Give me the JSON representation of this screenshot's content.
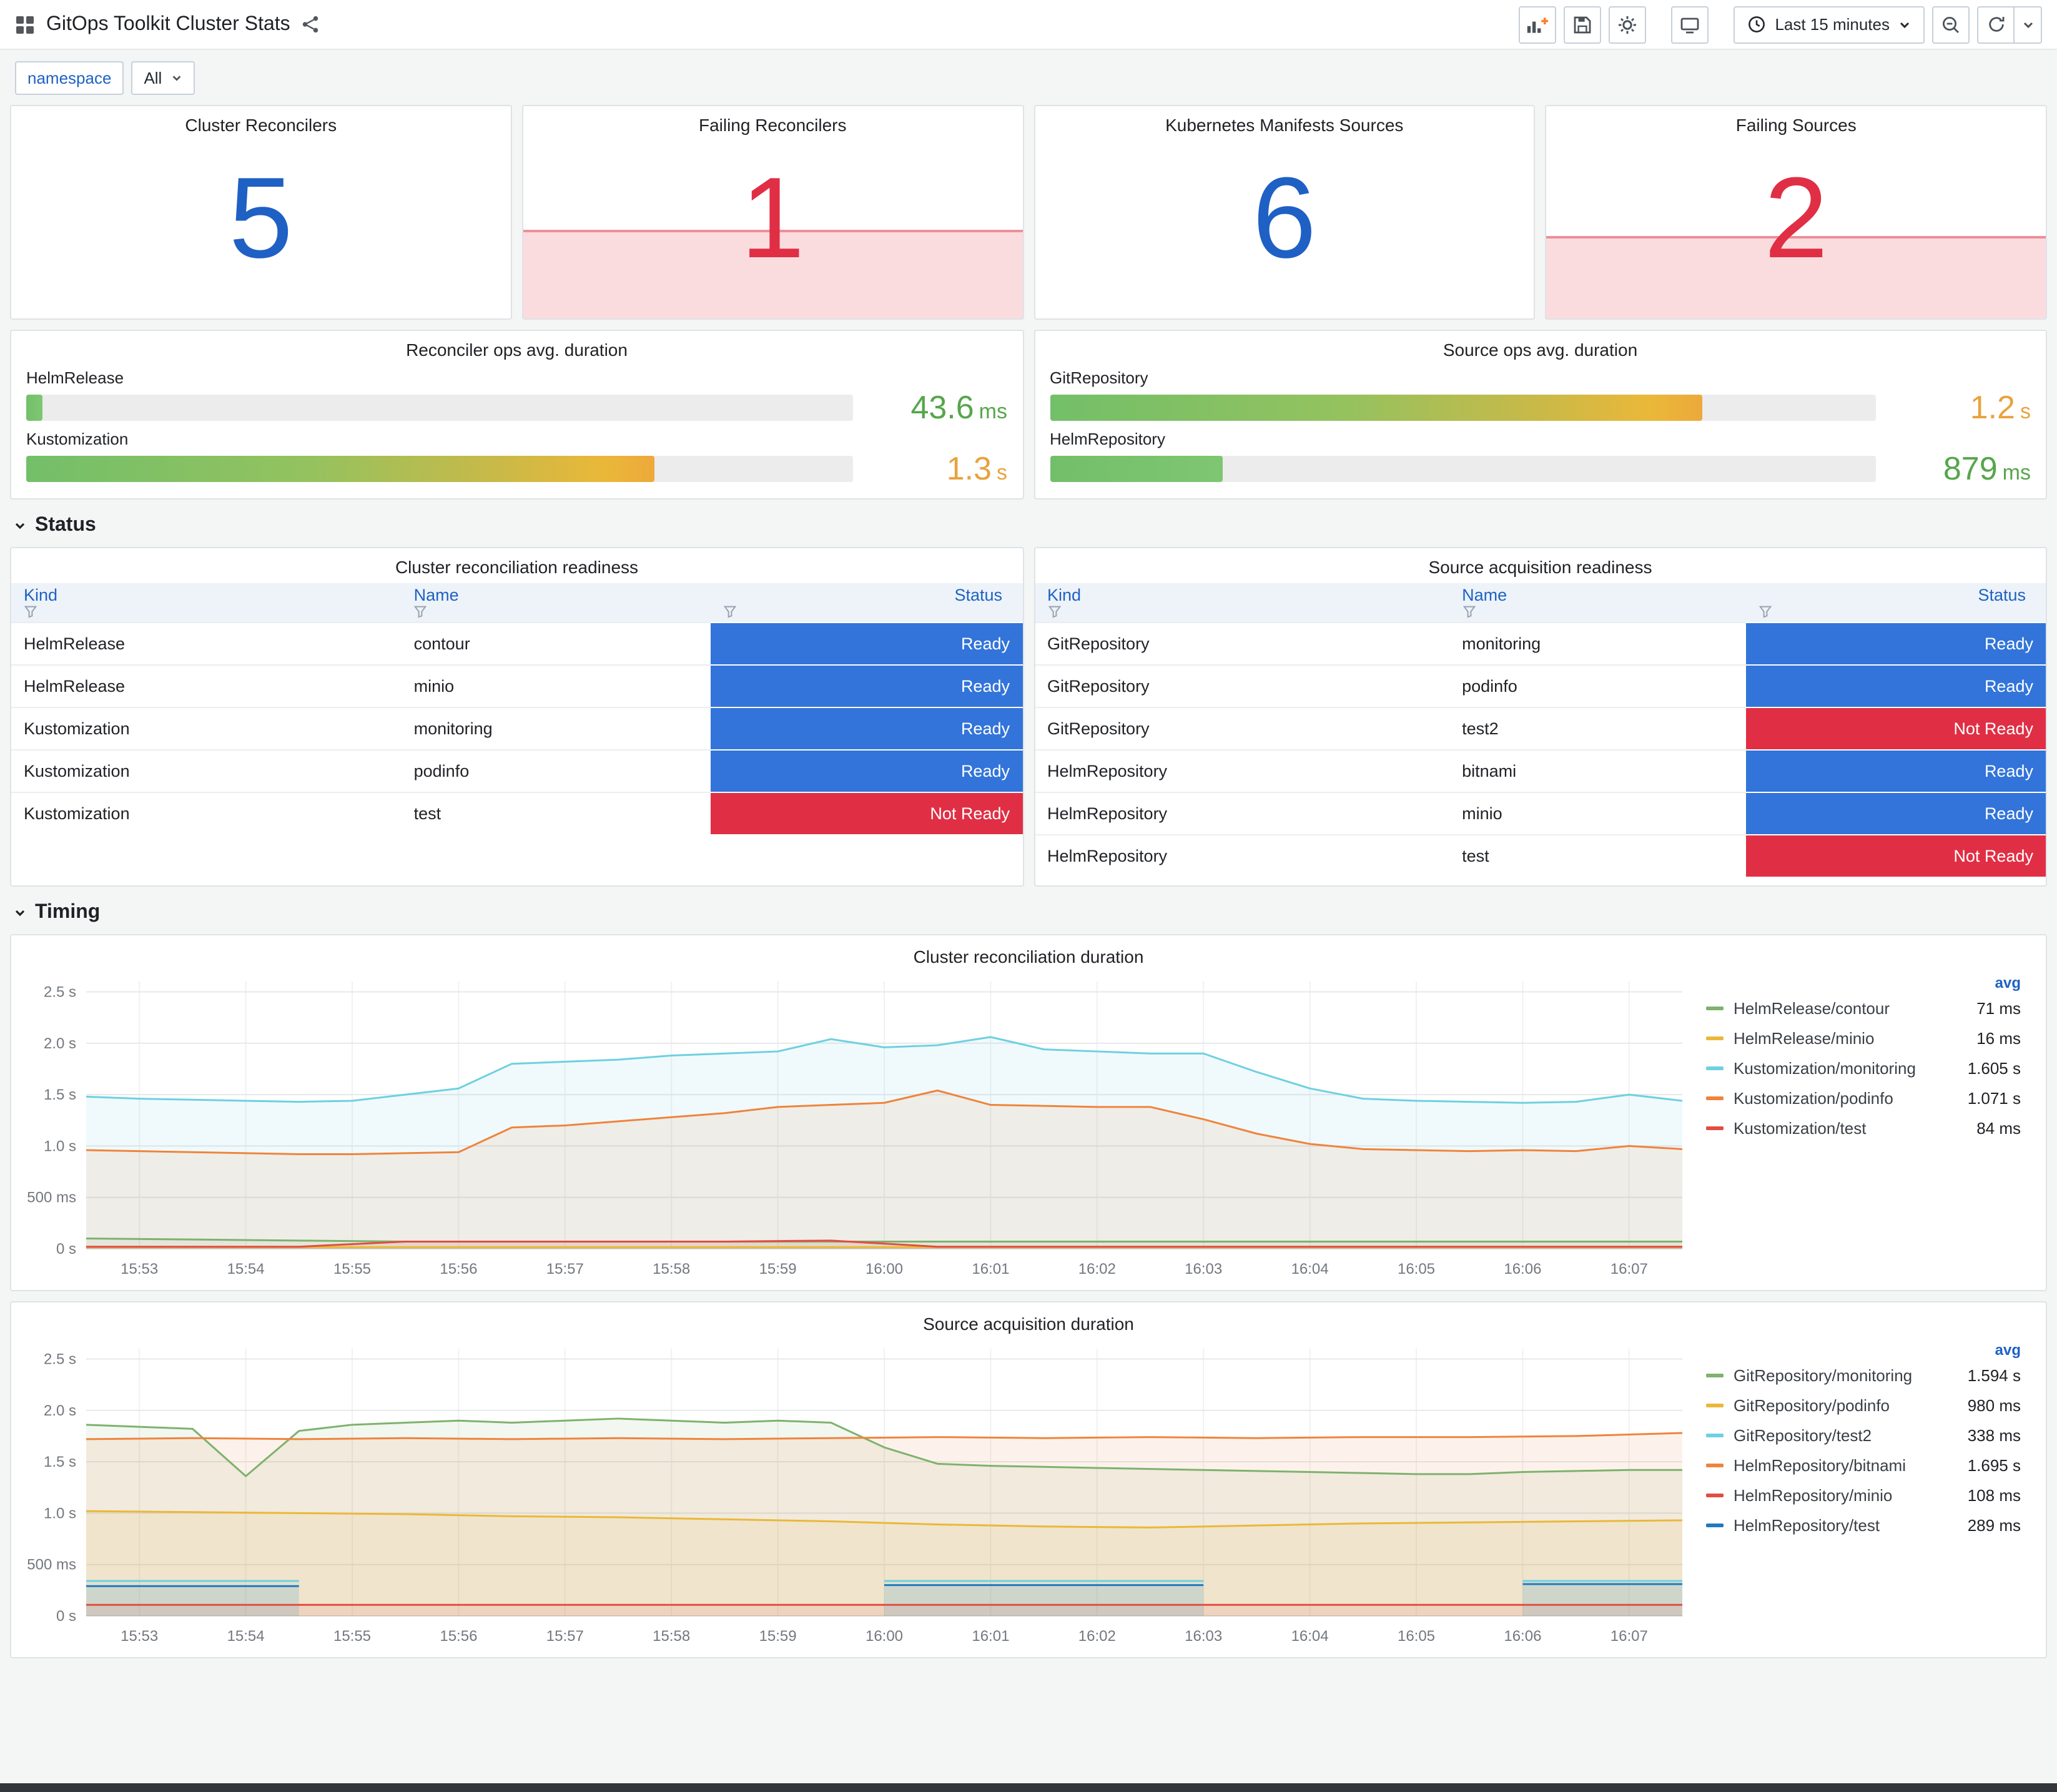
{
  "header": {
    "title": "GitOps Toolkit Cluster Stats",
    "time_range": "Last 15 minutes"
  },
  "variables": {
    "label": "namespace",
    "value": "All"
  },
  "colors": {
    "ok": "#1F60C4",
    "alert": "#E02F44",
    "value_green": "#56A64B",
    "value_orange": "#E8A33D"
  },
  "status_colors": {
    "Ready": "#3274D9",
    "Not Ready": "#E02F44"
  },
  "stat_panels": [
    {
      "title": "Cluster Reconcilers",
      "value": "5",
      "state": "ok"
    },
    {
      "title": "Failing Reconcilers",
      "value": "1",
      "state": "alert",
      "fill_pct": 42
    },
    {
      "title": "Kubernetes Manifests Sources",
      "value": "6",
      "state": "ok"
    },
    {
      "title": "Failing Sources",
      "value": "2",
      "state": "alert",
      "fill_pct": 39
    }
  ],
  "gauge_panels": [
    {
      "title": "Reconciler ops avg. duration",
      "rows": [
        {
          "label": "HelmRelease",
          "value": "43.6",
          "unit": "ms",
          "fraction": 2,
          "gradient": "green",
          "color": "green"
        },
        {
          "label": "Kustomization",
          "value": "1.3",
          "unit": "s",
          "fraction": 76,
          "gradient": "long",
          "color": "orange"
        }
      ]
    },
    {
      "title": "Source ops avg. duration",
      "rows": [
        {
          "label": "GitRepository",
          "value": "1.2",
          "unit": "s",
          "fraction": 79,
          "gradient": "long",
          "color": "orange"
        },
        {
          "label": "HelmRepository",
          "value": "879",
          "unit": "ms",
          "fraction": 21,
          "gradient": "green",
          "color": "green"
        }
      ]
    }
  ],
  "sections": [
    {
      "label": "Status"
    },
    {
      "label": "Timing"
    }
  ],
  "tables": [
    {
      "title": "Cluster reconciliation readiness",
      "columns": [
        "Kind",
        "Name",
        "Status"
      ],
      "rows": [
        [
          "HelmRelease",
          "contour",
          "Ready"
        ],
        [
          "HelmRelease",
          "minio",
          "Ready"
        ],
        [
          "Kustomization",
          "monitoring",
          "Ready"
        ],
        [
          "Kustomization",
          "podinfo",
          "Ready"
        ],
        [
          "Kustomization",
          "test",
          "Not Ready"
        ]
      ]
    },
    {
      "title": "Source acquisition readiness",
      "columns": [
        "Kind",
        "Name",
        "Status"
      ],
      "rows": [
        [
          "GitRepository",
          "monitoring",
          "Ready"
        ],
        [
          "GitRepository",
          "podinfo",
          "Ready"
        ],
        [
          "GitRepository",
          "test2",
          "Not Ready"
        ],
        [
          "HelmRepository",
          "bitnami",
          "Ready"
        ],
        [
          "HelmRepository",
          "minio",
          "Ready"
        ],
        [
          "HelmRepository",
          "test",
          "Not Ready"
        ]
      ]
    }
  ],
  "chart_data": [
    {
      "type": "line",
      "title": "Cluster reconciliation duration",
      "legend_header": "avg",
      "legend_position": "right",
      "grid": true,
      "ylim": [
        0,
        2.6
      ],
      "y_ticks": [
        {
          "v": 0,
          "label": "0 s"
        },
        {
          "v": 0.5,
          "label": "500 ms"
        },
        {
          "v": 1,
          "label": "1.0 s"
        },
        {
          "v": 1.5,
          "label": "1.5 s"
        },
        {
          "v": 2,
          "label": "2.0 s"
        },
        {
          "v": 2.5,
          "label": "2.5 s"
        }
      ],
      "x_tick_labels": [
        "15:53",
        "15:54",
        "15:55",
        "15:56",
        "15:57",
        "15:58",
        "15:59",
        "16:00",
        "16:01",
        "16:02",
        "16:03",
        "16:04",
        "16:05",
        "16:06",
        "16:07"
      ],
      "series": [
        {
          "name": "HelmRelease/contour",
          "color": "#7EB26D",
          "avg": "71 ms",
          "values": [
            0.1,
            0.09,
            0.08,
            0.07,
            0.07,
            0.07,
            0.07,
            0.07,
            0.07,
            0.07,
            0.07,
            0.07,
            0.07,
            0.07,
            0.07,
            0.07
          ]
        },
        {
          "name": "HelmRelease/minio",
          "color": "#EAB839",
          "avg": "16 ms",
          "values": [
            0.016,
            0.016
          ]
        },
        {
          "name": "Kustomization/monitoring",
          "color": "#6ED0E0",
          "avg": "1.605 s",
          "values": [
            1.48,
            1.46,
            1.45,
            1.44,
            1.43,
            1.44,
            1.5,
            1.56,
            1.8,
            1.82,
            1.84,
            1.88,
            1.9,
            1.92,
            2.04,
            1.96,
            1.98,
            2.06,
            1.94,
            1.92,
            1.9,
            1.9,
            1.72,
            1.56,
            1.46,
            1.44,
            1.43,
            1.42,
            1.43,
            1.5,
            1.44
          ]
        },
        {
          "name": "Kustomization/podinfo",
          "color": "#EF843C",
          "avg": "1.071 s",
          "values": [
            0.96,
            0.95,
            0.94,
            0.93,
            0.92,
            0.92,
            0.93,
            0.94,
            1.18,
            1.2,
            1.24,
            1.28,
            1.32,
            1.38,
            1.4,
            1.42,
            1.54,
            1.4,
            1.39,
            1.38,
            1.38,
            1.26,
            1.12,
            1.02,
            0.97,
            0.96,
            0.95,
            0.96,
            0.95,
            1.0,
            0.97
          ]
        },
        {
          "name": "Kustomization/test",
          "color": "#E24D42",
          "avg": "84 ms",
          "values": [
            0.02,
            0.02,
            0.02,
            0.07,
            0.07,
            0.07,
            0.07,
            0.08,
            0.02,
            0.02,
            0.02,
            0.02,
            0.02,
            0.02,
            0.02,
            0.02
          ]
        }
      ]
    },
    {
      "type": "line",
      "title": "Source acquisition duration",
      "legend_header": "avg",
      "legend_position": "right",
      "grid": true,
      "ylim": [
        0,
        2.6
      ],
      "y_ticks": [
        {
          "v": 0,
          "label": "0 s"
        },
        {
          "v": 0.5,
          "label": "500 ms"
        },
        {
          "v": 1,
          "label": "1.0 s"
        },
        {
          "v": 1.5,
          "label": "1.5 s"
        },
        {
          "v": 2,
          "label": "2.0 s"
        },
        {
          "v": 2.5,
          "label": "2.5 s"
        }
      ],
      "x_tick_labels": [
        "15:53",
        "15:54",
        "15:55",
        "15:56",
        "15:57",
        "15:58",
        "15:59",
        "16:00",
        "16:01",
        "16:02",
        "16:03",
        "16:04",
        "16:05",
        "16:06",
        "16:07"
      ],
      "series": [
        {
          "name": "GitRepository/monitoring",
          "color": "#7EB26D",
          "avg": "1.594 s",
          "values": [
            1.86,
            1.84,
            1.82,
            1.36,
            1.8,
            1.86,
            1.88,
            1.9,
            1.88,
            1.9,
            1.92,
            1.9,
            1.88,
            1.9,
            1.88,
            1.64,
            1.48,
            1.46,
            1.45,
            1.44,
            1.43,
            1.42,
            1.41,
            1.4,
            1.39,
            1.38,
            1.38,
            1.4,
            1.41,
            1.42,
            1.42
          ]
        },
        {
          "name": "GitRepository/podinfo",
          "color": "#EAB839",
          "avg": "980 ms",
          "values": [
            1.02,
            1.01,
            1.0,
            0.99,
            0.97,
            0.96,
            0.94,
            0.92,
            0.89,
            0.87,
            0.86,
            0.88,
            0.9,
            0.91,
            0.92,
            0.93
          ]
        },
        {
          "name": "GitRepository/test2",
          "color": "#6ED0E0",
          "avg": "338 ms",
          "values": [
            0.34,
            0.34,
            0.34,
            0.34,
            0.34,
            null,
            null,
            null,
            null,
            null,
            null,
            null,
            null,
            null,
            null,
            0.34,
            0.34,
            0.34,
            0.34,
            0.34,
            0.34,
            0.34,
            null,
            null,
            null,
            null,
            null,
            0.34,
            0.34,
            0.34,
            0.34
          ]
        },
        {
          "name": "HelmRepository/bitnami",
          "color": "#EF843C",
          "avg": "1.695 s",
          "values": [
            1.72,
            1.73,
            1.72,
            1.73,
            1.72,
            1.73,
            1.72,
            1.73,
            1.74,
            1.73,
            1.74,
            1.73,
            1.74,
            1.74,
            1.75,
            1.78
          ]
        },
        {
          "name": "HelmRepository/minio",
          "color": "#E24D42",
          "avg": "108 ms",
          "values": [
            0.108,
            0.108
          ]
        },
        {
          "name": "HelmRepository/test",
          "color": "#1F78C1",
          "avg": "289 ms",
          "values": [
            0.29,
            0.29,
            0.29,
            0.29,
            0.29,
            null,
            null,
            null,
            null,
            null,
            null,
            null,
            null,
            null,
            null,
            0.3,
            0.3,
            0.3,
            0.3,
            0.3,
            0.3,
            0.3,
            null,
            null,
            null,
            null,
            null,
            0.31,
            0.31,
            0.31,
            0.31
          ]
        }
      ]
    }
  ]
}
